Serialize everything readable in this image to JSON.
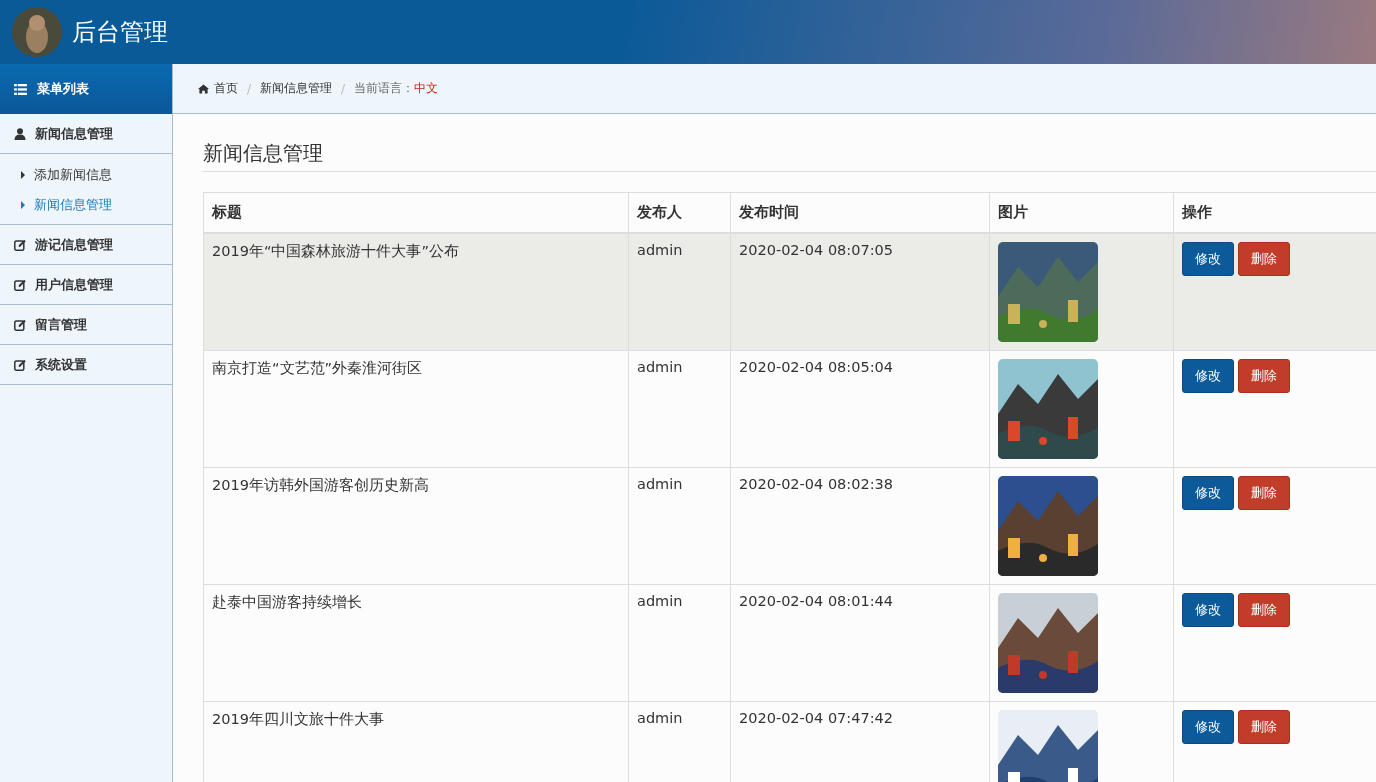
{
  "header": {
    "title": "后台管理"
  },
  "sidebar": {
    "heading": "菜单列表",
    "groups": [
      {
        "label": "新闻信息管理",
        "kind": "user",
        "children": [
          {
            "label": "添加新闻信息",
            "selected": false
          },
          {
            "label": "新闻信息管理",
            "selected": true
          }
        ]
      },
      {
        "label": "游记信息管理",
        "kind": "edit"
      },
      {
        "label": "用户信息管理",
        "kind": "edit"
      },
      {
        "label": "留言管理",
        "kind": "edit"
      },
      {
        "label": "系统设置",
        "kind": "edit"
      }
    ]
  },
  "breadcrumb": {
    "items": [
      "首页",
      "新闻信息管理"
    ],
    "separators": [
      "/",
      "/"
    ],
    "language_label": "当前语言：",
    "language": "中文"
  },
  "page_title": "新闻信息管理",
  "table": {
    "columns": [
      "标题",
      "发布人",
      "发布时间",
      "图片",
      "操作"
    ],
    "rows": [
      {
        "title": "2019年“中国森林旅游十件大事”公布",
        "author": "admin",
        "time": "2020-02-04 08:07:05",
        "actions": [
          "修改",
          "删除"
        ],
        "highlighted": true
      },
      {
        "title": "南京打造“文艺范”外秦淮河街区",
        "author": "admin",
        "time": "2020-02-04 08:05:04",
        "actions": [
          "修改",
          "删除"
        ],
        "highlighted": false
      },
      {
        "title": "2019年访韩外国游客创历史新高",
        "author": "admin",
        "time": "2020-02-04 08:02:38",
        "actions": [
          "修改",
          "删除"
        ],
        "highlighted": false
      },
      {
        "title": "赴泰中国游客持续增长",
        "author": "admin",
        "time": "2020-02-04 08:01:44",
        "actions": [
          "修改",
          "删除"
        ],
        "highlighted": false
      },
      {
        "title": "2019年四川文旅十件大事",
        "author": "admin",
        "time": "2020-02-04 07:47:42",
        "actions": [
          "修改",
          "删除"
        ],
        "highlighted": false
      }
    ]
  }
}
